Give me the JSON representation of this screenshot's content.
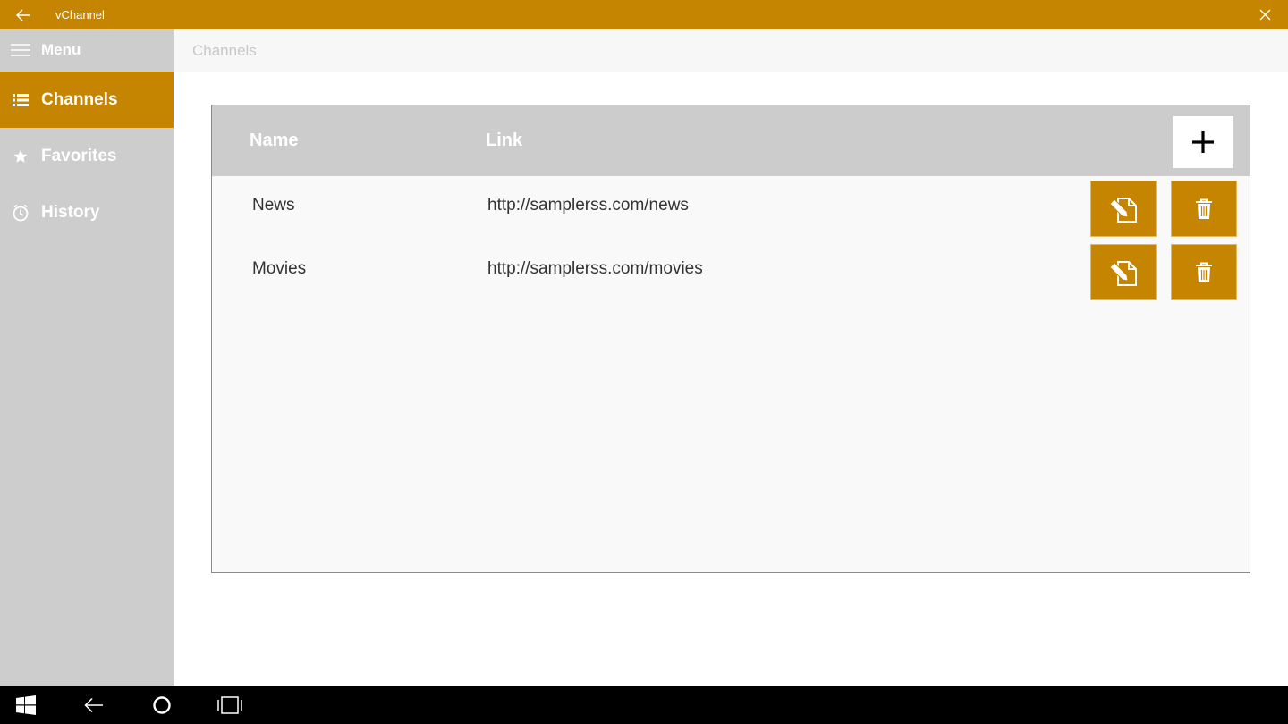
{
  "window": {
    "title": "vChannel",
    "accent_color": "#c68500"
  },
  "sidebar": {
    "menu_label": "Menu",
    "items": [
      {
        "label": "Channels",
        "icon": "list-icon",
        "active": true
      },
      {
        "label": "Favorites",
        "icon": "star-icon",
        "active": false
      },
      {
        "label": "History",
        "icon": "clock-icon",
        "active": false
      }
    ]
  },
  "header": {
    "breadcrumb": "Channels"
  },
  "table": {
    "columns": [
      "Name",
      "Link"
    ],
    "add_icon": "plus-icon",
    "rows": [
      {
        "name": "News",
        "link": "http://samplerss.com/news"
      },
      {
        "name": "Movies",
        "link": "http://samplerss.com/movies"
      }
    ],
    "row_actions": [
      "edit-icon",
      "trash-icon"
    ]
  },
  "taskbar": {
    "buttons": [
      "windows-start-icon",
      "back-arrow-icon",
      "cortana-circle-icon",
      "task-view-icon"
    ]
  }
}
